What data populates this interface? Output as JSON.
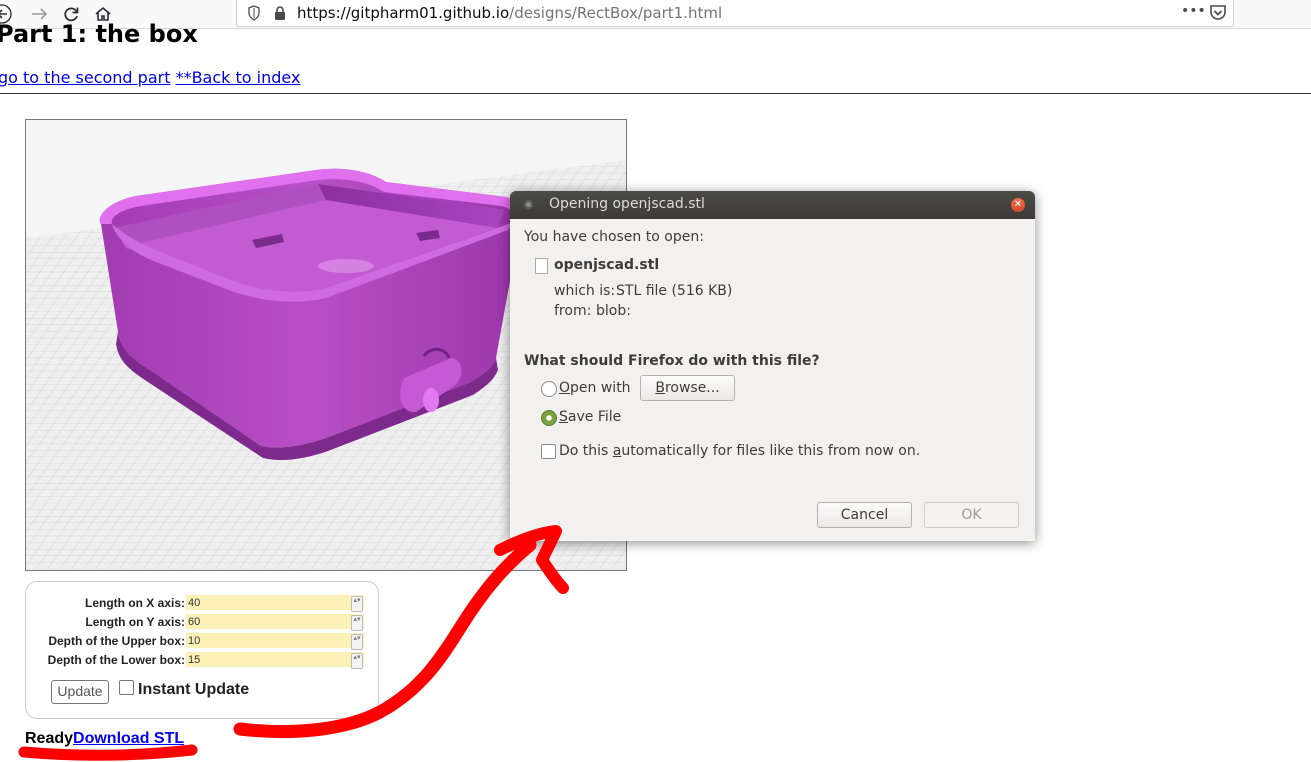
{
  "browser": {
    "url_host": "https://gitpharm01.github.io",
    "url_path": "/designs/RectBox/part1.html",
    "more_label": "•••"
  },
  "page": {
    "title": "Part 1: the box",
    "link_second_part": "go to the second part",
    "link_back_index": "**Back to index"
  },
  "params": {
    "rows": [
      {
        "label": "Length on X axis:",
        "value": "40"
      },
      {
        "label": "Length on Y axis:",
        "value": "60"
      },
      {
        "label": "Depth of the Upper box:",
        "value": "10"
      },
      {
        "label": "Depth of the Lower box:",
        "value": "15"
      }
    ],
    "update_label": "Update",
    "instant_label": "Instant Update"
  },
  "status": {
    "ready": "Ready",
    "download": "Download STL"
  },
  "dialog": {
    "title": "Opening openjscad.stl",
    "chosen": "You have chosen to open:",
    "filename": "openjscad.stl",
    "which_is_label": "which is:",
    "which_is_value": "STL file (516 KB)",
    "from_label": "from:",
    "from_value": "blob:",
    "question": "What should Firefox do with this file?",
    "open_with_pre": "",
    "open_with_mn": "O",
    "open_with_post": "pen with",
    "browse_pre": "",
    "browse_mn": "B",
    "browse_post": "rowse...",
    "save_mn": "S",
    "save_post": "ave File",
    "auto_pre": "Do this ",
    "auto_mn": "a",
    "auto_post": "utomatically for files like this from now on.",
    "cancel": "Cancel",
    "ok": "OK",
    "selected_option": "Save File"
  },
  "colors": {
    "box_purple": "#b04fbf",
    "annotation_red": "#ff0000",
    "link_blue": "#0000ee",
    "input_yellow": "#fbf0b5"
  }
}
